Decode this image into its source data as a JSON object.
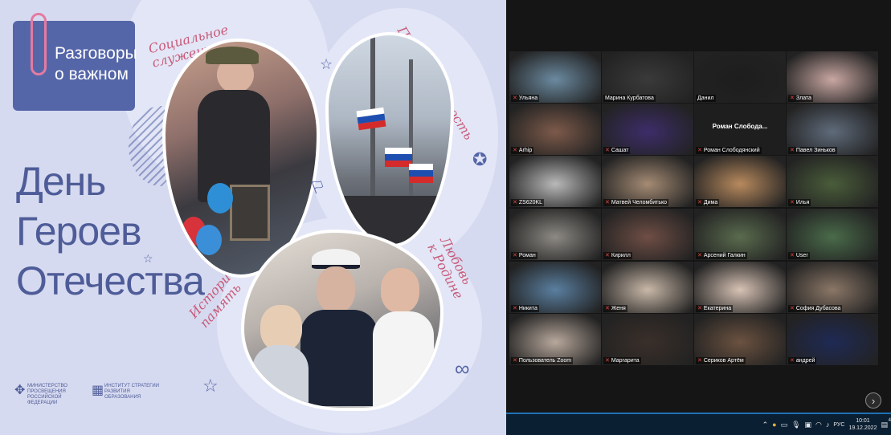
{
  "slide": {
    "brand_title": "Разговоры о важном",
    "hero_title_lines": [
      "День",
      "Героев",
      "Отечества"
    ],
    "tags": {
      "social": "Социальное\nслужение",
      "continuity": "Преемственность\nпоколений",
      "history": "Историческая\nпамять",
      "love": "Любовь\nк Родине"
    },
    "logo_ministry": "МИНИСТЕРСТВО ПРОСВЕЩЕНИЯ РОССИЙСКОЙ ФЕДЕРАЦИИ",
    "logo_institute": "ИНСТИТУТ СТРАТЕГИИ РАЗВИТИЯ ОБРАЗОВАНИЯ",
    "colors": {
      "accent": "#5566a8",
      "pink": "#c85b7a",
      "bg": "#d6daf0"
    }
  },
  "meeting": {
    "participants": [
      {
        "name": "Ульяна",
        "tone": "#6b8aa0",
        "muted": true
      },
      {
        "name": "Марина Курбатова",
        "tone": "#3a3a3a",
        "muted": false
      },
      {
        "name": "Данил",
        "tone": "#1d1d1d",
        "muted": false,
        "speaking": true
      },
      {
        "name": "Злата",
        "tone": "#c9a7a2",
        "muted": true
      },
      {
        "name": "Arhip",
        "tone": "#7d5a4a",
        "muted": true
      },
      {
        "name": "Сашат",
        "tone": "#3d2d6a",
        "muted": true
      },
      {
        "name": "Роман Слободянский",
        "tone": "#2a2a2a",
        "muted": true,
        "placeholder": "Роман Слобода..."
      },
      {
        "name": "Павел Зиньков",
        "tone": "#5f6b7b",
        "muted": true
      },
      {
        "name": "ZS620KL",
        "tone": "#b9b9b9",
        "muted": true
      },
      {
        "name": "Матвей Челомбитько",
        "tone": "#a58b74",
        "muted": true
      },
      {
        "name": "Дима",
        "tone": "#b88a5e",
        "muted": true
      },
      {
        "name": "Илья",
        "tone": "#4a5d3a",
        "muted": true
      },
      {
        "name": "Роман",
        "tone": "#8d8a84",
        "muted": true
      },
      {
        "name": "Кирилл",
        "tone": "#6f4e45",
        "muted": true
      },
      {
        "name": "Арсений Галкин",
        "tone": "#5a6b4e",
        "muted": true
      },
      {
        "name": "User",
        "tone": "#4a6b4a",
        "muted": true
      },
      {
        "name": "Никита",
        "tone": "#5a7fa0",
        "muted": true
      },
      {
        "name": "Женя",
        "tone": "#c9b8a8",
        "muted": true
      },
      {
        "name": "Екатерина",
        "tone": "#d8c3b5",
        "muted": true
      },
      {
        "name": "София Дубасова",
        "tone": "#8b7767",
        "muted": true
      },
      {
        "name": "Пользователь Zoom",
        "tone": "#b8a89c",
        "muted": true
      },
      {
        "name": "Маргарита",
        "tone": "#3a2f2a",
        "muted": true
      },
      {
        "name": "Сериков Артём",
        "tone": "#6b5240",
        "muted": true
      },
      {
        "name": "андрей",
        "tone": "#1f2a55",
        "muted": true
      }
    ],
    "taskbar": {
      "lang": "РУС",
      "time": "10:01",
      "date": "19.12.2022",
      "notif_count": "4"
    }
  }
}
